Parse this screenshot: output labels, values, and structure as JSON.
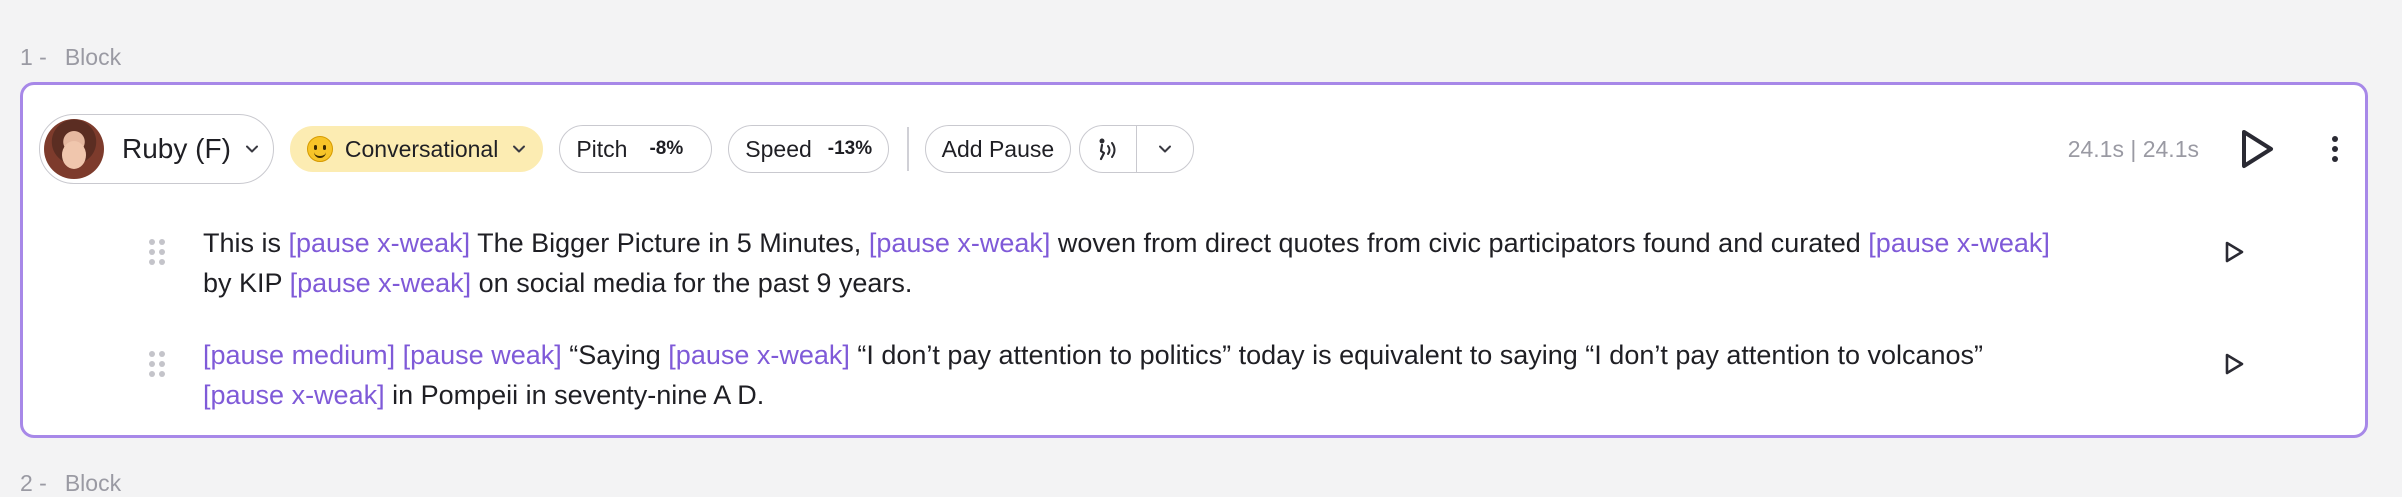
{
  "blocks": [
    {
      "number": "1 -",
      "label": "Block"
    },
    {
      "number": "2 -",
      "label": "Block"
    }
  ],
  "toolbar": {
    "voice_name": "Ruby (F)",
    "style_label": "Conversational",
    "pitch_label": "Pitch",
    "pitch_value": "-8%",
    "speed_label": "Speed",
    "speed_value": "-13%",
    "add_pause_label": "Add Pause",
    "duration": "24.1s | 24.1s"
  },
  "lines": [
    {
      "segments": [
        {
          "text": "This is ",
          "tag": false
        },
        {
          "text": "[pause x-weak]",
          "tag": true
        },
        {
          "text": " The Bigger Picture in 5 Minutes, ",
          "tag": false
        },
        {
          "text": "[pause x-weak]",
          "tag": true
        },
        {
          "text": " woven from direct quotes from civic participators found and curated ",
          "tag": false
        },
        {
          "text": "[pause x-weak]",
          "tag": true
        },
        {
          "text": " by KIP ",
          "tag": false
        },
        {
          "text": "[pause x-weak]",
          "tag": true
        },
        {
          "text": " on social media for the past 9 years.",
          "tag": false
        }
      ]
    },
    {
      "segments": [
        {
          "text": "[pause medium]",
          "tag": true
        },
        {
          "text": " ",
          "tag": false
        },
        {
          "text": "[pause weak]",
          "tag": true
        },
        {
          "text": " “Saying ",
          "tag": false
        },
        {
          "text": "[pause x-weak]",
          "tag": true
        },
        {
          "text": " “I don’t pay attention to politics” today is equivalent to saying “I don’t pay attention to volcanos” ",
          "tag": false
        },
        {
          "text": "[pause x-weak]",
          "tag": true
        },
        {
          "text": " in Pompeii in seventy-nine A D.",
          "tag": false
        }
      ]
    }
  ],
  "colors": {
    "accent": "#a788e8",
    "tag": "#7f5ad8",
    "style_bg": "#fcecb2"
  },
  "icons": [
    "chevron-down-icon",
    "smiley-emoji-icon",
    "breath-icon",
    "play-icon",
    "more-vertical-icon",
    "drag-handle-icon"
  ]
}
